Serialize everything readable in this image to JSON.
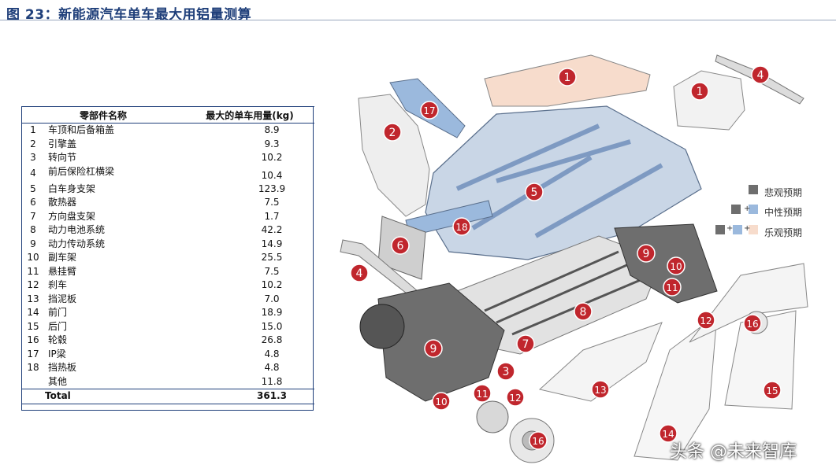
{
  "title": "图 23：新能源汽车单车最大用铝量测算",
  "table": {
    "header": {
      "part": "零部件名称",
      "value": "最大的单车用量(kg)"
    },
    "rows": [
      {
        "n": "1",
        "name": "车顶和后备箱盖",
        "value": "8.9"
      },
      {
        "n": "2",
        "name": "引擎盖",
        "value": "9.3"
      },
      {
        "n": "3",
        "name": "转向节",
        "value": "10.2"
      },
      {
        "n": "4",
        "name": "前后保险杠横梁",
        "value": "10.4"
      },
      {
        "n": "5",
        "name": "白车身支架",
        "value": "123.9"
      },
      {
        "n": "6",
        "name": "散热器",
        "value": "7.5"
      },
      {
        "n": "7",
        "name": "方向盘支架",
        "value": "1.7"
      },
      {
        "n": "8",
        "name": "动力电池系统",
        "value": "42.2"
      },
      {
        "n": "9",
        "name": "动力传动系统",
        "value": "14.9"
      },
      {
        "n": "10",
        "name": "副车架",
        "value": "25.5"
      },
      {
        "n": "11",
        "name": "悬挂臂",
        "value": "7.5"
      },
      {
        "n": "12",
        "name": "刹车",
        "value": "10.2"
      },
      {
        "n": "13",
        "name": "挡泥板",
        "value": "7.0"
      },
      {
        "n": "14",
        "name": "前门",
        "value": "18.9"
      },
      {
        "n": "15",
        "name": "后门",
        "value": "15.0"
      },
      {
        "n": "16",
        "name": "轮毂",
        "value": "26.8"
      },
      {
        "n": "17",
        "name": "IP梁",
        "value": "4.8"
      },
      {
        "n": "18",
        "name": "挡热板",
        "value": "4.8"
      },
      {
        "n": "",
        "name": "其他",
        "value": "11.8"
      }
    ],
    "total": {
      "label": "Total",
      "value": "361.3"
    }
  },
  "legend": {
    "pessimistic": "悲观预期",
    "neutral": "中性预期",
    "optimistic": "乐观预期",
    "plus": "+",
    "colors": {
      "grey": "#6e6e6e",
      "blue": "#9bb9dd",
      "peach": "#f7dccc"
    }
  },
  "diagram": {
    "markers": [
      "1",
      "1",
      "2",
      "3",
      "4",
      "4",
      "5",
      "6",
      "7",
      "8",
      "9",
      "9",
      "10",
      "10",
      "11",
      "11",
      "12",
      "12",
      "13",
      "14",
      "15",
      "16",
      "16",
      "17",
      "18"
    ]
  },
  "watermark": "头条 @未来智库",
  "colors": {
    "marker": "#c0262d",
    "title": "#1f3f7a"
  }
}
